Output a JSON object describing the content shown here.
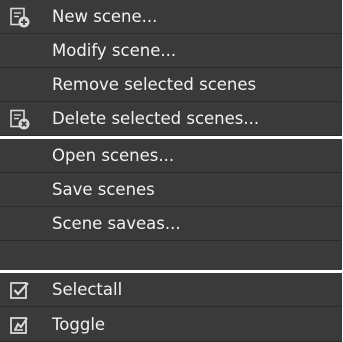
{
  "menu": {
    "groups": [
      {
        "items": [
          {
            "label": "New scene...",
            "icon": "new-scene-icon"
          },
          {
            "label": "Modify scene...",
            "icon": ""
          },
          {
            "label": "Remove selected scenes",
            "icon": ""
          },
          {
            "label": "Delete selected scenes...",
            "icon": "delete-scene-icon"
          }
        ]
      },
      {
        "items": [
          {
            "label": "Open scenes...",
            "icon": ""
          },
          {
            "label": "Save scenes",
            "icon": ""
          },
          {
            "label": "Scene saveas...",
            "icon": ""
          }
        ]
      },
      {
        "items": [
          {
            "label": "Selectall",
            "icon": "checkbox-checked-icon"
          },
          {
            "label": "Toggle",
            "icon": "toggle-icon"
          }
        ]
      }
    ]
  },
  "colors": {
    "menu_background": "#3a3a3a",
    "menu_text": "#f2f2f2",
    "separator": "#ffffff"
  }
}
